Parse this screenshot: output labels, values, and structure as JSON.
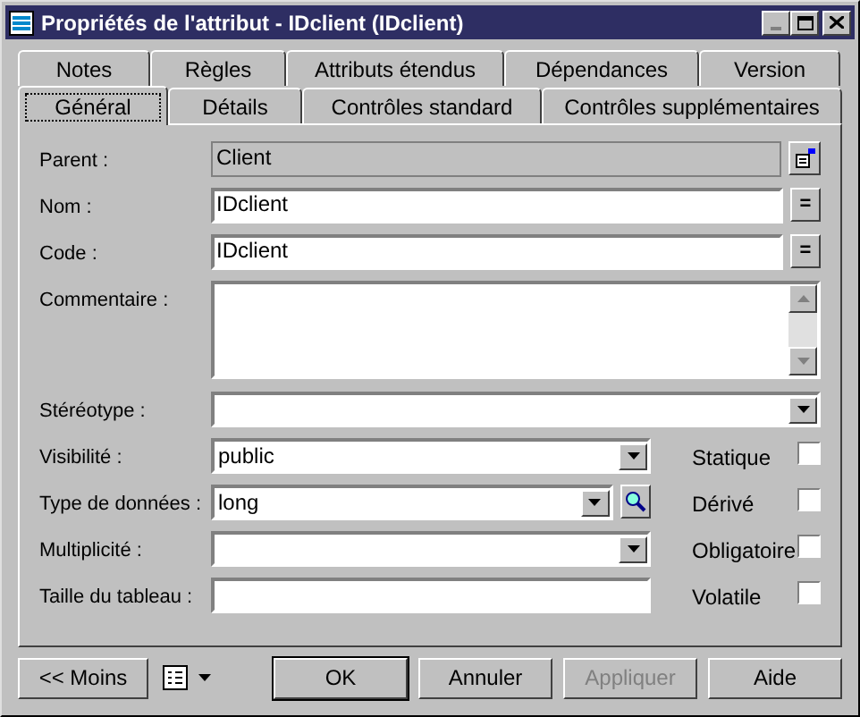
{
  "window": {
    "title": "Propriétés de l'attribut - IDclient (IDclient)"
  },
  "tabs_back": [
    {
      "label": "Notes",
      "selected": false
    },
    {
      "label": "Règles",
      "selected": false
    },
    {
      "label": "Attributs étendus",
      "selected": false
    },
    {
      "label": "Dépendances",
      "selected": false
    },
    {
      "label": "Version",
      "selected": false
    }
  ],
  "tabs_front": [
    {
      "label": "Général",
      "selected": true
    },
    {
      "label": "Détails",
      "selected": false
    },
    {
      "label": "Contrôles standard",
      "selected": false
    },
    {
      "label": "Contrôles supplémentaires",
      "selected": false
    }
  ],
  "fields": [
    {
      "kind": "readonly",
      "label": "Parent :",
      "value": "Client"
    },
    {
      "kind": "text",
      "label": "Nom :",
      "value": "IDclient",
      "side_button": {
        "kind": "equals",
        "label": "="
      }
    },
    {
      "kind": "text",
      "label": "Code :",
      "value": "IDclient",
      "side_button": {
        "kind": "equals",
        "label": "="
      }
    },
    {
      "kind": "textarea",
      "label": "Commentaire :"
    },
    {
      "kind": "combo",
      "label": "Stéréotype :",
      "wide": true
    },
    {
      "kind": "combo",
      "label": "Visibilité :",
      "value": "public"
    },
    {
      "kind": "combo",
      "label": "Type de données :",
      "value": "long",
      "side_button": {
        "kind": "browse"
      }
    },
    {
      "kind": "combo",
      "label": "Multiplicité :"
    },
    {
      "kind": "text",
      "label": "Taille du tableau :"
    }
  ],
  "checkboxes": [
    {
      "label": "Statique",
      "checked": false
    },
    {
      "label": "Dérivé",
      "checked": false
    },
    {
      "label": "Obligatoire",
      "checked": false
    },
    {
      "label": "Volatile",
      "checked": false
    }
  ],
  "more_button": "<< Moins",
  "buttons": [
    {
      "label": "OK",
      "disabled": false,
      "default": true
    },
    {
      "label": "Annuler",
      "disabled": false,
      "default": false
    },
    {
      "label": "Appliquer",
      "disabled": true,
      "default": false
    },
    {
      "label": "Aide",
      "disabled": false,
      "default": false
    }
  ]
}
